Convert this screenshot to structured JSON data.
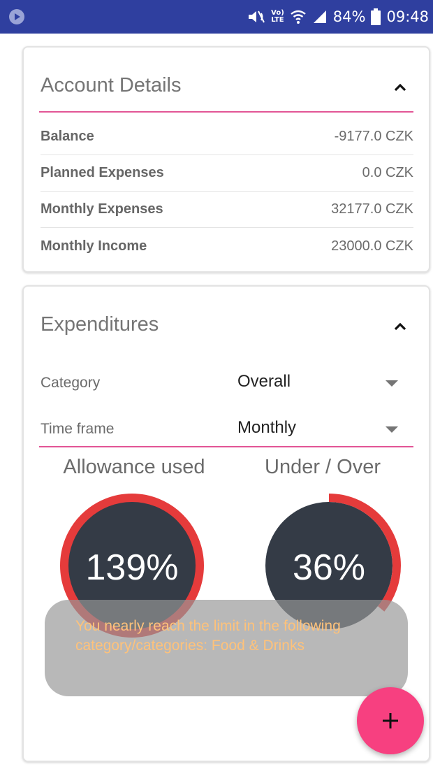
{
  "status_bar": {
    "battery": "84%",
    "time": "09:48",
    "lte_top": "Vo)",
    "lte_bottom": "LTE"
  },
  "account_details": {
    "title": "Account Details",
    "rows": [
      {
        "label": "Balance",
        "value": "-9177.0 CZK"
      },
      {
        "label": "Planned Expenses",
        "value": "0.0 CZK"
      },
      {
        "label": "Monthly Expenses",
        "value": "32177.0 CZK"
      },
      {
        "label": "Monthly Income",
        "value": "23000.0 CZK"
      }
    ]
  },
  "expenditures": {
    "title": "Expenditures",
    "category_label": "Category",
    "category_value": "Overall",
    "timeframe_label": "Time frame",
    "timeframe_value": "Monthly",
    "allowance_header": "Allowance used",
    "allowance_text": "139%",
    "allowance_fraction": 1.0,
    "under_over_header": "Under / Over",
    "under_over_text": "36%",
    "under_over_fraction": 0.36
  },
  "toast": {
    "message": "You nearly reach the limit in the following category/categories: Food & Drinks"
  },
  "colors": {
    "status_bar": "#2f3f9f",
    "accent": "#e25596",
    "gauge_fill": "#343b46",
    "gauge_ring": "#e53b3b",
    "fab": "#f74080",
    "toast_text": "#ffc27a"
  },
  "icons": {
    "status_left": "media-play-icon",
    "collapse": "chevron-up-icon",
    "fab": "plus-icon"
  }
}
